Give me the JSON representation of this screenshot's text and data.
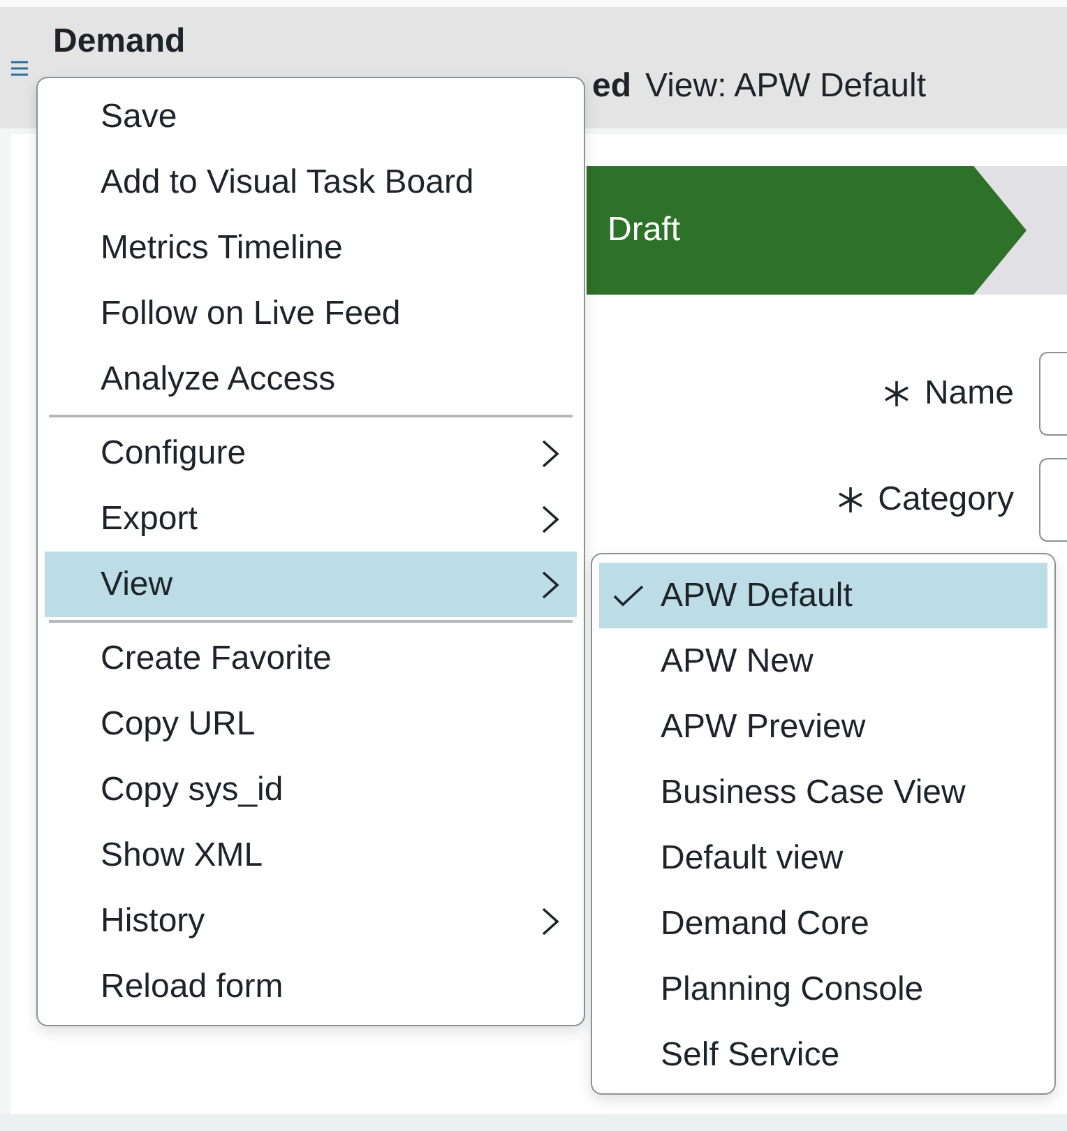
{
  "header": {
    "title": "Demand",
    "subtitle_visible": "ed",
    "view_label": "View: APW Default"
  },
  "stage": {
    "label": "Draft"
  },
  "form_fields": [
    {
      "label": "Name",
      "required": true
    },
    {
      "label": "Category",
      "required": true
    }
  ],
  "context_menu": {
    "groups": [
      [
        {
          "label": "Save",
          "submenu": false,
          "selected": false
        },
        {
          "label": "Add to Visual Task Board",
          "submenu": false,
          "selected": false
        },
        {
          "label": "Metrics Timeline",
          "submenu": false,
          "selected": false
        },
        {
          "label": "Follow on Live Feed",
          "submenu": false,
          "selected": false
        },
        {
          "label": "Analyze Access",
          "submenu": false,
          "selected": false
        }
      ],
      [
        {
          "label": "Configure",
          "submenu": true,
          "selected": false
        },
        {
          "label": "Export",
          "submenu": true,
          "selected": false
        },
        {
          "label": "View",
          "submenu": true,
          "selected": true
        }
      ],
      [
        {
          "label": "Create Favorite",
          "submenu": false,
          "selected": false
        },
        {
          "label": "Copy URL",
          "submenu": false,
          "selected": false
        },
        {
          "label": "Copy sys_id",
          "submenu": false,
          "selected": false
        },
        {
          "label": "Show XML",
          "submenu": false,
          "selected": false
        },
        {
          "label": "History",
          "submenu": true,
          "selected": false
        },
        {
          "label": "Reload form",
          "submenu": false,
          "selected": false
        }
      ]
    ]
  },
  "view_submenu": [
    {
      "label": "APW Default",
      "checked": true,
      "selected": true
    },
    {
      "label": "APW New",
      "checked": false,
      "selected": false
    },
    {
      "label": "APW Preview",
      "checked": false,
      "selected": false
    },
    {
      "label": "Business Case View",
      "checked": false,
      "selected": false
    },
    {
      "label": "Default view",
      "checked": false,
      "selected": false
    },
    {
      "label": "Demand Core",
      "checked": false,
      "selected": false
    },
    {
      "label": "Planning Console",
      "checked": false,
      "selected": false
    },
    {
      "label": "Self Service",
      "checked": false,
      "selected": false
    }
  ]
}
